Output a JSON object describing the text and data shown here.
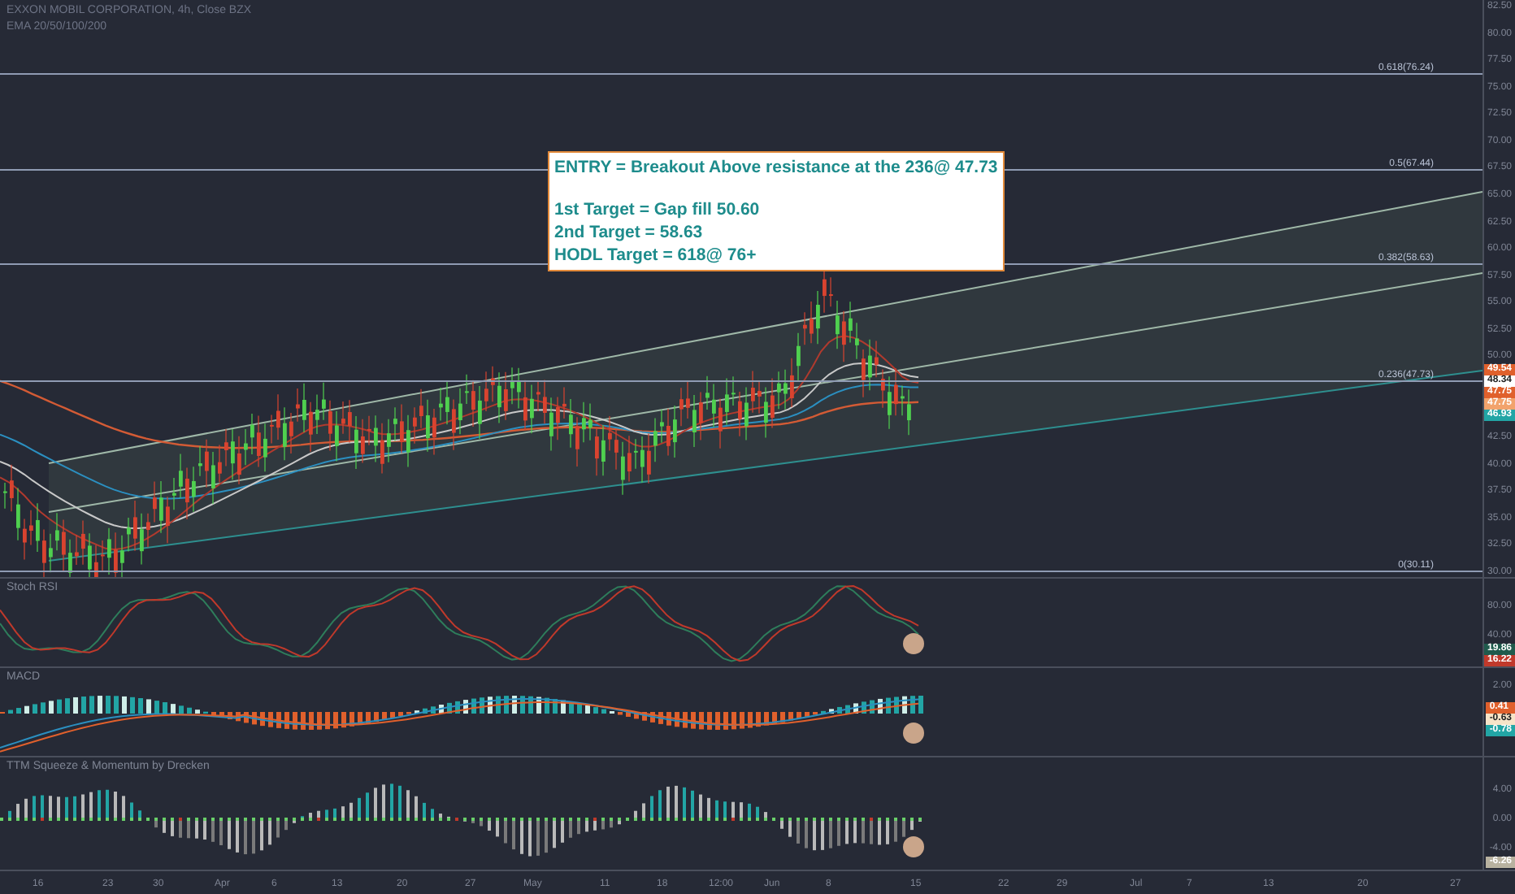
{
  "header": {
    "symbol": "EXXON MOBIL CORPORATION, 4h, Close BZX",
    "indicator": "EMA 20/50/100/200"
  },
  "price_axis": [
    "82.50",
    "80.00",
    "77.50",
    "75.00",
    "72.50",
    "70.00",
    "67.50",
    "65.00",
    "62.50",
    "60.00",
    "57.50",
    "55.00",
    "52.50",
    "50.00",
    "42.50",
    "40.00",
    "37.50",
    "35.00",
    "32.50",
    "30.00"
  ],
  "fib_levels": [
    {
      "label": "0.618(76.24)"
    },
    {
      "label": "0.5(67.44)"
    },
    {
      "label": "0.382(58.63)"
    },
    {
      "label": "0.236(47.73)"
    },
    {
      "label": "0(30.11)"
    }
  ],
  "price_tags": [
    {
      "text": "49.54",
      "color": "#e0602c"
    },
    {
      "text": "48.34",
      "color": "#ffffff"
    },
    {
      "text": "47.75",
      "color": "#e0602c"
    },
    {
      "text": "47.75",
      "color": "#f2a36c"
    },
    {
      "text": "46.93",
      "color": "#22a5a5"
    }
  ],
  "annotation": {
    "lines": [
      "ENTRY = Breakout Above resistance at the 236@ 47.73",
      "1st Target = Gap fill 50.60",
      "2nd Target = 58.63",
      "HODL Target = 618@ 76+"
    ]
  },
  "panels": [
    {
      "kind": "stoch",
      "title": "Stoch RSI",
      "axis": [
        "80.00",
        "40.00"
      ],
      "tags": [
        {
          "text": "19.86",
          "color": "#1f5a4c"
        },
        {
          "text": "16.22",
          "color": "#c0392b"
        }
      ]
    },
    {
      "kind": "macd",
      "title": "MACD",
      "axis": [
        "2.00"
      ],
      "tags": [
        {
          "text": "0.41",
          "color": "#e0602c"
        },
        {
          "text": "-0.63",
          "color": "#f7e4c8"
        },
        {
          "text": "-0.78",
          "color": "#22a5a5"
        }
      ]
    },
    {
      "kind": "ttm",
      "title": "TTM Squeeze & Momentum by Drecken",
      "axis": [
        "4.00",
        "0.00",
        "-4.00"
      ],
      "tags": [
        {
          "text": "-6.26",
          "color": "#b8b2a0"
        }
      ]
    }
  ],
  "time_axis": [
    "16",
    "23",
    "30",
    "Apr",
    "6",
    "13",
    "20",
    "27",
    "May",
    "11",
    "18",
    "12:00",
    "Jun",
    "8",
    "15",
    "22",
    "29",
    "Jul",
    "7",
    "13",
    "20",
    "27"
  ]
}
